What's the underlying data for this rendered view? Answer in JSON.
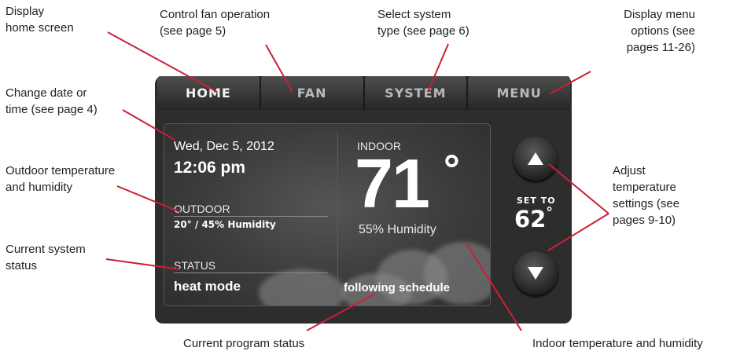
{
  "callouts": {
    "home": "Display\nhome screen",
    "fan": "Control fan operation\n(see page 5)",
    "system": "Select system\ntype (see page 6)",
    "menu": "Display menu\noptions (see\npages 11-26)",
    "date_time": "Change date or\ntime (see page 4)",
    "outdoor": "Outdoor temperature\nand humidity",
    "status": "Current system\nstatus",
    "adjust": "Adjust\ntemperature\nsettings (see\npages 9-10)",
    "program": "Current program status",
    "indoor": "Indoor temperature and humidity"
  },
  "tabs": {
    "home": "HOME",
    "fan": "FAN",
    "system": "SYSTEM",
    "menu": "MENU"
  },
  "screen": {
    "date": "Wed, Dec 5, 2012",
    "time": "12:06 pm",
    "outdoor_label": "OUTDOOR",
    "outdoor_value": "20° / 45% Humidity",
    "status_label": "STATUS",
    "status_value": "heat mode",
    "indoor_label": "INDOOR",
    "indoor_temp": "71",
    "indoor_degree": "°",
    "indoor_humidity": "55% Humidity",
    "schedule": "following schedule"
  },
  "setpoint": {
    "label": "SET TO",
    "value": "62",
    "degree": "°"
  },
  "icons": {
    "up": "up-arrow-icon",
    "down": "down-arrow-icon"
  },
  "colors": {
    "leader": "#cc1f36",
    "device": "#2d2d2d"
  }
}
